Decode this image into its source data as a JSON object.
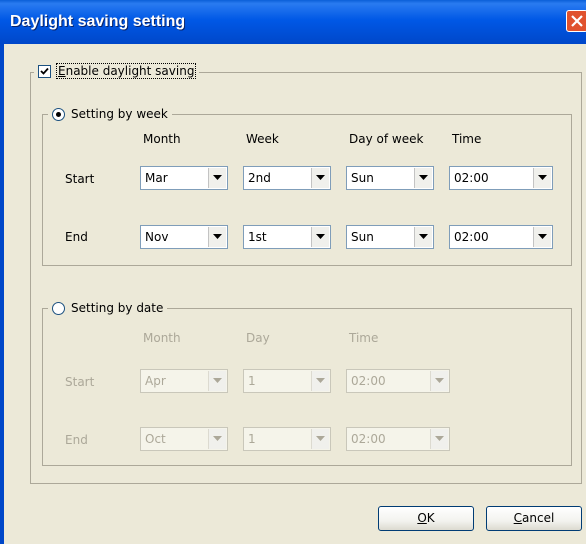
{
  "window": {
    "title": "Daylight saving setting"
  },
  "enable": {
    "pre": "",
    "mnemonic": "E",
    "rest": "nable daylight saving",
    "checked": true
  },
  "by_week": {
    "label": "Setting by week",
    "selected": true,
    "headers": {
      "month": "Month",
      "week": "Week",
      "day": "Day of week",
      "time": "Time"
    },
    "start": {
      "label": "Start",
      "month": "Mar",
      "week": "2nd",
      "day": "Sun",
      "time": "02:00"
    },
    "end": {
      "label": "End",
      "month": "Nov",
      "week": "1st",
      "day": "Sun",
      "time": "02:00"
    }
  },
  "by_date": {
    "label": "Setting by date",
    "selected": false,
    "headers": {
      "month": "Month",
      "day": "Day",
      "time": "Time"
    },
    "start": {
      "label": "Start",
      "month": "Apr",
      "day": "1",
      "time": "02:00"
    },
    "end": {
      "label": "End",
      "month": "Oct",
      "day": "1",
      "time": "02:00"
    }
  },
  "buttons": {
    "ok": {
      "mnemonic": "O",
      "rest": "K"
    },
    "cancel": {
      "mnemonic": "C",
      "rest": "ancel"
    }
  },
  "colors": {
    "titlebar": "#0058e6",
    "close": "#e0522e",
    "face": "#ece9d8"
  },
  "icons": {
    "close": "close-icon",
    "check": "check-icon",
    "dropdown": "dropdown-arrow-icon"
  }
}
